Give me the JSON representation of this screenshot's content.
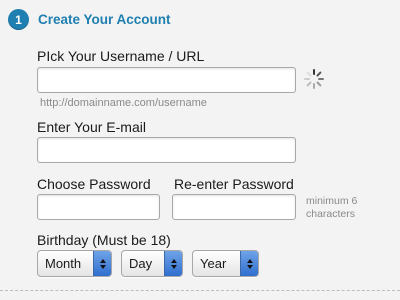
{
  "step": {
    "number": "1",
    "title": "Create Your Account"
  },
  "username": {
    "label": "PIck Your Username / URL",
    "value": "",
    "hint": "http://domainname.com/username"
  },
  "email": {
    "label": "Enter Your E-mail",
    "value": ""
  },
  "password": {
    "label": "Choose Password",
    "value": ""
  },
  "password_confirm": {
    "label": "Re-enter Password",
    "value": ""
  },
  "password_hint": "minimum 6 characters",
  "birthday": {
    "label": "Birthday (Must be 18)",
    "month": "Month",
    "day": "Day",
    "year": "Year"
  },
  "colors": {
    "accent": "#1f7fb0",
    "select_arrow": "#3d7fd9"
  },
  "icons": {
    "loading": "spinner-icon"
  }
}
